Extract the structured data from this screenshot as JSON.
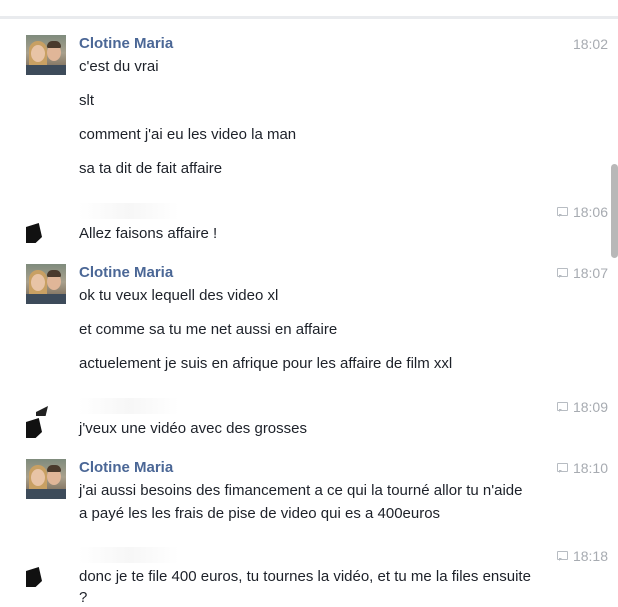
{
  "messages": [
    {
      "sender": "Clotine Maria",
      "avatar": "photo",
      "time": "18:02",
      "show_icon": false,
      "lines": [
        "c'est du vrai",
        "slt",
        "comment j'ai eu les video la man",
        "sa ta dit de fait affaire"
      ]
    },
    {
      "sender": "",
      "avatar": "redacted",
      "time": "18:06",
      "show_icon": true,
      "lines": [
        "Allez faisons affaire !"
      ]
    },
    {
      "sender": "Clotine Maria",
      "avatar": "photo",
      "time": "18:07",
      "show_icon": true,
      "lines": [
        "ok tu veux lequell des video xl",
        "et comme sa tu me net aussi en affaire",
        "actuelement je suis en afrique pour les affaire de film xxl"
      ]
    },
    {
      "sender": "",
      "avatar": "redacted",
      "time": "18:09",
      "show_icon": true,
      "lines": [
        "j'veux une vidéo avec des grosses"
      ]
    },
    {
      "sender": "Clotine Maria",
      "avatar": "photo",
      "time": "18:10",
      "show_icon": true,
      "lines": [
        "j'ai aussi besoins des fimancement a ce qui la tourné allor tu n'aide",
        "a payé les les frais de pise de video qui es a 400euros"
      ]
    },
    {
      "sender": "",
      "avatar": "redacted",
      "time": "18:18",
      "show_icon": true,
      "lines": [
        "donc je te file 400 euros, tu tournes la vidéo, et tu me la files ensuite",
        "?"
      ]
    }
  ],
  "colors": {
    "sender": "#4b6796",
    "text": "#1d2129",
    "time": "#a7abb1"
  }
}
